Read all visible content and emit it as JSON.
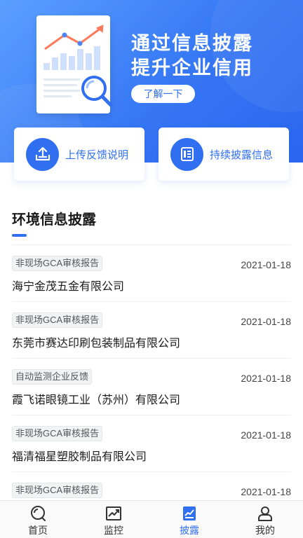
{
  "banner": {
    "title_line1": "通过信息披露",
    "title_line2": "提升企业信用",
    "button": "了解一下"
  },
  "actions": [
    {
      "label": "上传反馈说明",
      "icon": "upload-icon"
    },
    {
      "label": "持续披露信息",
      "icon": "document-list-icon"
    }
  ],
  "section": {
    "title": "环境信息披露"
  },
  "items": [
    {
      "tag": "非现场GCA审核报告",
      "date": "2021-01-18",
      "company": "海宁金茂五金有限公司"
    },
    {
      "tag": "非现场GCA审核报告",
      "date": "2021-01-18",
      "company": "东莞市赛达印刷包装制品有限公司"
    },
    {
      "tag": "自动监测企业反馈",
      "date": "2021-01-18",
      "company": "霞飞诺眼镜工业（苏州）有限公司"
    },
    {
      "tag": "非现场GCA审核报告",
      "date": "2021-01-18",
      "company": "福清福星塑胶制品有限公司"
    },
    {
      "tag": "非现场GCA审核报告",
      "date": "2021-01-18",
      "company": ""
    }
  ],
  "tabs": [
    {
      "label": "首页",
      "icon": "home-search-icon",
      "active": false
    },
    {
      "label": "监控",
      "icon": "chart-monitor-icon",
      "active": false
    },
    {
      "label": "披露",
      "icon": "disclosure-icon",
      "active": true
    },
    {
      "label": "我的",
      "icon": "user-icon",
      "active": false
    }
  ],
  "colors": {
    "accent": "#2f6ff0",
    "banner_light": "#5aa0ff",
    "banner_dark": "#2a66ee"
  }
}
